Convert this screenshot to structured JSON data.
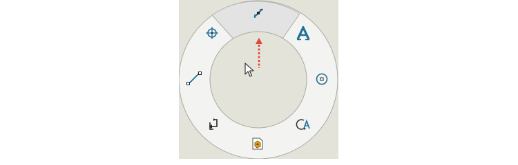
{
  "window": {
    "background": "#e3e3d9"
  },
  "colors": {
    "ring": "#f3f3f1",
    "ring_border": "#a9a9a3",
    "highlight": "#e3e3e3",
    "icon_blue": "#1f6f99",
    "arrow_red": "#e0463b"
  },
  "gesture": {
    "direction": "up",
    "selected": "smart-dimension",
    "items": [
      {
        "icon": "smart-dimension-icon",
        "direction": "up"
      },
      {
        "icon": "note-text-icon",
        "direction": "up-right"
      },
      {
        "icon": "circle-icon",
        "direction": "right"
      },
      {
        "icon": "rotate-text-icon",
        "direction": "down-right"
      },
      {
        "icon": "part-file-icon",
        "direction": "down"
      },
      {
        "icon": "swap-icon",
        "direction": "down-left"
      },
      {
        "icon": "line-icon",
        "direction": "left"
      },
      {
        "icon": "centerpoint-icon",
        "direction": "up-left"
      }
    ]
  }
}
